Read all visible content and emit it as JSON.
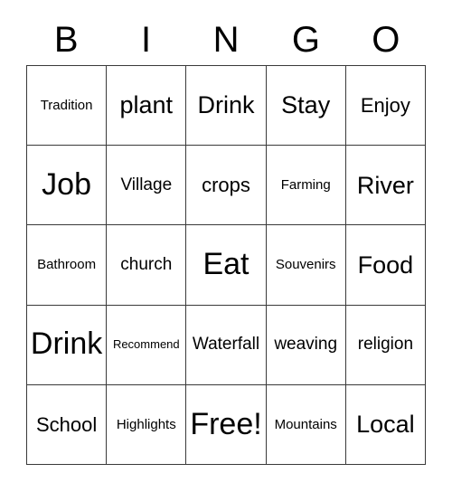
{
  "card": {
    "type": "bingo-card",
    "header_letters": [
      "B",
      "I",
      "N",
      "G",
      "O"
    ],
    "colors": {
      "background": "#ffffff",
      "text": "#000000",
      "grid_line": "#3a3a3a"
    },
    "rows": [
      [
        {
          "label": "Tradition",
          "size": "s"
        },
        {
          "label": "plant",
          "size": "xl"
        },
        {
          "label": "Drink",
          "size": "xl"
        },
        {
          "label": "Stay",
          "size": "xl"
        },
        {
          "label": "Enjoy",
          "size": "l"
        }
      ],
      [
        {
          "label": "Job",
          "size": "xxl"
        },
        {
          "label": "Village",
          "size": "m"
        },
        {
          "label": "crops",
          "size": "l"
        },
        {
          "label": "Farming",
          "size": "s"
        },
        {
          "label": "River",
          "size": "xl"
        }
      ],
      [
        {
          "label": "Bathroom",
          "size": "s"
        },
        {
          "label": "church",
          "size": "m"
        },
        {
          "label": "Eat",
          "size": "xxl"
        },
        {
          "label": "Souvenirs",
          "size": "s"
        },
        {
          "label": "Food",
          "size": "xl"
        }
      ],
      [
        {
          "label": "Drink",
          "size": "xxl"
        },
        {
          "label": "Recommend",
          "size": "xs"
        },
        {
          "label": "Waterfall",
          "size": "m"
        },
        {
          "label": "weaving",
          "size": "m"
        },
        {
          "label": "religion",
          "size": "m"
        }
      ],
      [
        {
          "label": "School",
          "size": "l"
        },
        {
          "label": "Highlights",
          "size": "s"
        },
        {
          "label": "Free!",
          "size": "xxl"
        },
        {
          "label": "Mountains",
          "size": "s"
        },
        {
          "label": "Local",
          "size": "xl"
        }
      ]
    ],
    "free_space": {
      "label": "Free!",
      "row": 5,
      "column": 3
    }
  }
}
